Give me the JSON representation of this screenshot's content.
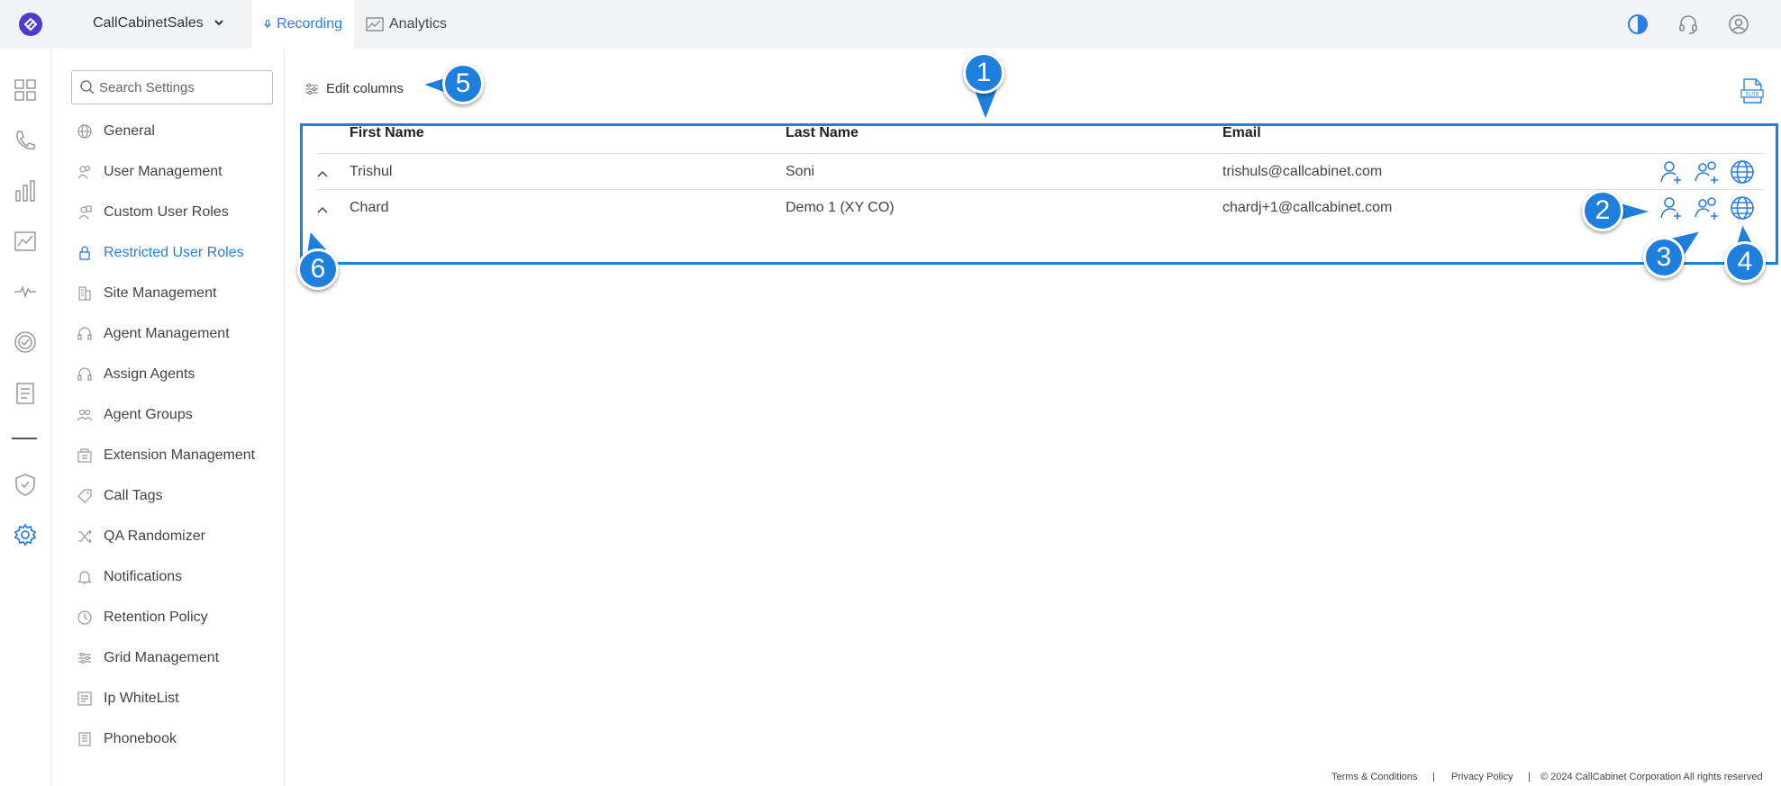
{
  "topbar": {
    "org_name": "CallCabinetSales",
    "tabs": [
      {
        "label": "Recording",
        "icon": "microphone-icon",
        "active": true
      },
      {
        "label": "Analytics",
        "icon": "chart-line-icon",
        "active": false
      }
    ],
    "right_icons": [
      "theme-toggle-icon",
      "headset-icon",
      "user-account-icon"
    ]
  },
  "rail": {
    "icons": [
      "dashboard-icon",
      "phone-icon",
      "bar-chart-icon",
      "analytics-icon",
      "pulse-icon",
      "check-circle-icon",
      "clipboard-icon",
      "shield-icon",
      "settings-icon"
    ]
  },
  "menu": {
    "search_placeholder": "Search Settings",
    "items": [
      {
        "label": "General",
        "icon": "globe-icon"
      },
      {
        "label": "User Management",
        "icon": "users-icon"
      },
      {
        "label": "Custom User Roles",
        "icon": "user-role-icon"
      },
      {
        "label": "Restricted User Roles",
        "icon": "lock-icon",
        "active": true
      },
      {
        "label": "Site Management",
        "icon": "building-icon"
      },
      {
        "label": "Agent Management",
        "icon": "headset-icon"
      },
      {
        "label": "Assign Agents",
        "icon": "headset-icon"
      },
      {
        "label": "Agent Groups",
        "icon": "group-icon"
      },
      {
        "label": "Extension Management",
        "icon": "extension-icon"
      },
      {
        "label": "Call Tags",
        "icon": "tag-icon"
      },
      {
        "label": "QA Randomizer",
        "icon": "shuffle-icon"
      },
      {
        "label": "Notifications",
        "icon": "bell-icon"
      },
      {
        "label": "Retention Policy",
        "icon": "clock-icon"
      },
      {
        "label": "Grid Management",
        "icon": "sliders-icon"
      },
      {
        "label": "Ip WhiteList",
        "icon": "list-icon"
      },
      {
        "label": "Phonebook",
        "icon": "phonebook-icon"
      }
    ]
  },
  "main": {
    "edit_columns_label": "Edit columns",
    "export_icon": "xlsx-export-icon",
    "table": {
      "headers": [
        "First Name",
        "Last Name",
        "Email"
      ],
      "rows": [
        {
          "first": "Trishul",
          "last": "Soni",
          "email": "trishuls@callcabinet.com"
        },
        {
          "first": "Chard",
          "last": "Demo 1 (XY CO)",
          "email": "chardj+1@callcabinet.com"
        }
      ],
      "row_actions": [
        "add-user-icon",
        "add-users-icon",
        "globe-icon"
      ]
    }
  },
  "callouts": [
    "1",
    "2",
    "3",
    "4",
    "5",
    "6"
  ],
  "footer": {
    "terms": "Terms & Conditions",
    "privacy": "Privacy Policy",
    "separator": "|",
    "copyright": "© 2024 CallCabinet Corporation All rights reserved"
  },
  "colors": {
    "accent": "#2a7de1",
    "callout": "#1e7fdc"
  }
}
